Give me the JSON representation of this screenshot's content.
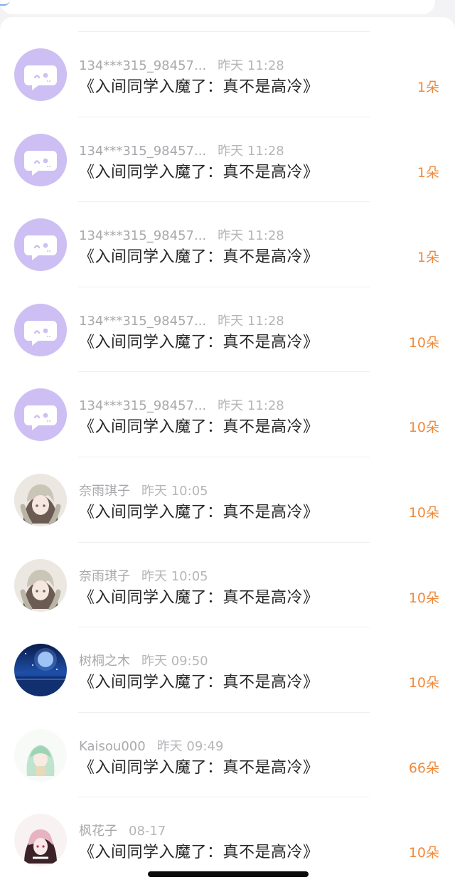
{
  "rows": [
    {
      "name": "134***315_98457...",
      "time": "昨天 11:28",
      "title": "《入间同学入魔了：真不是高冷》",
      "amount": "1朵",
      "avatar": "bot-avatar"
    },
    {
      "name": "134***315_98457...",
      "time": "昨天 11:28",
      "title": "《入间同学入魔了：真不是高冷》",
      "amount": "1朵",
      "avatar": "bot-avatar"
    },
    {
      "name": "134***315_98457...",
      "time": "昨天 11:28",
      "title": "《入间同学入魔了：真不是高冷》",
      "amount": "1朵",
      "avatar": "bot-avatar"
    },
    {
      "name": "134***315_98457...",
      "time": "昨天 11:28",
      "title": "《入间同学入魔了：真不是高冷》",
      "amount": "10朵",
      "avatar": "bot-avatar"
    },
    {
      "name": "134***315_98457...",
      "time": "昨天 11:28",
      "title": "《入间同学入魔了：真不是高冷》",
      "amount": "10朵",
      "avatar": "bot-avatar"
    },
    {
      "name": "奈雨琪子",
      "time": "昨天 10:05",
      "title": "《入间同学入魔了：真不是高冷》",
      "amount": "10朵",
      "avatar": "anime-girl-avatar"
    },
    {
      "name": "奈雨琪子",
      "time": "昨天 10:05",
      "title": "《入间同学入魔了：真不是高冷》",
      "amount": "10朵",
      "avatar": "anime-girl-avatar"
    },
    {
      "name": "树桐之木",
      "time": "昨天 09:50",
      "title": "《入间同学入魔了：真不是高冷》",
      "amount": "10朵",
      "avatar": "night-sky-avatar"
    },
    {
      "name": "Kaisou000",
      "time": "昨天 09:49",
      "title": "《入间同学入魔了：真不是高冷》",
      "amount": "66朵",
      "avatar": "green-hair-avatar"
    },
    {
      "name": "枫花子",
      "time": "08-17",
      "title": "《入间同学入魔了：真不是高冷》",
      "amount": "10朵",
      "avatar": "pink-hair-avatar"
    }
  ],
  "colors": {
    "amount": "#ef8a3c",
    "bot_avatar": "#cdbff3",
    "meta": "#a9a9ad",
    "title": "#262626"
  }
}
